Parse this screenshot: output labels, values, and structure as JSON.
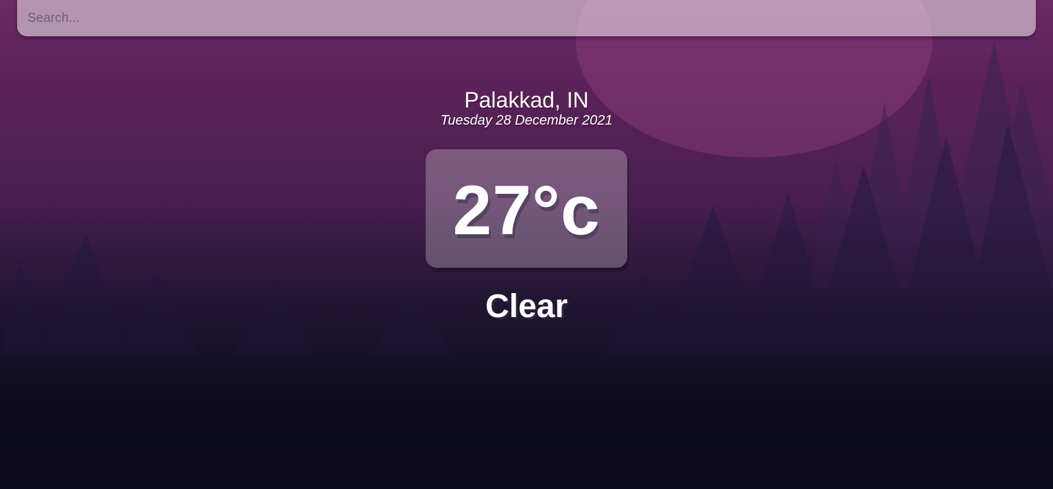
{
  "search": {
    "placeholder": "Search...",
    "value": ""
  },
  "location": {
    "name": "Palakkad, IN",
    "date": "Tuesday 28 December 2021"
  },
  "weather": {
    "temperature": "27°c",
    "condition": "Clear"
  },
  "colors": {
    "background_top": "#6b2a66",
    "background_bottom": "#0c0a1b",
    "text": "#ffffff"
  }
}
